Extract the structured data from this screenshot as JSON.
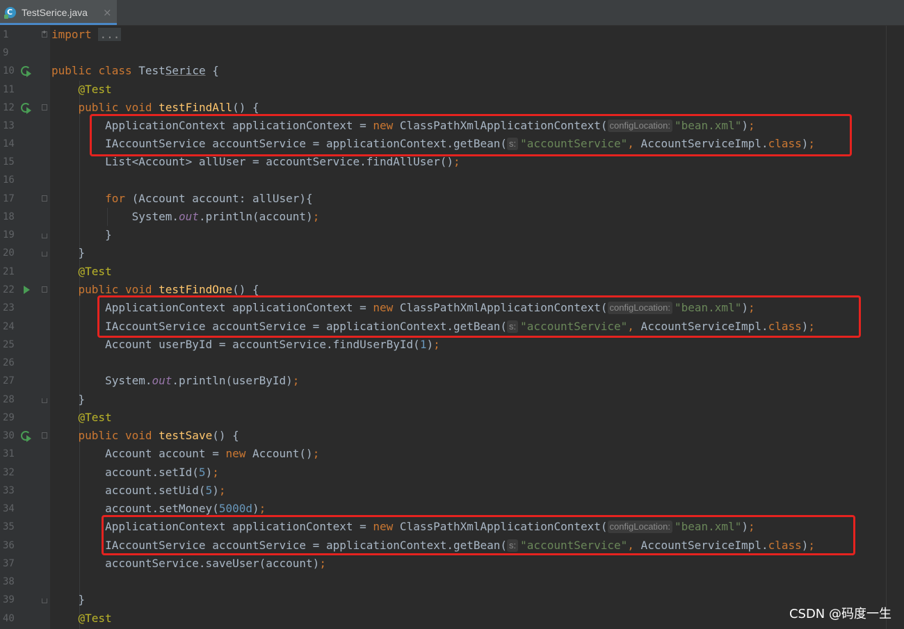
{
  "tab": {
    "title": "TestSerice.java",
    "close": "×"
  },
  "watermark": "CSDN @码度一生",
  "lines": {
    "l1": {
      "num": "1",
      "kw": "import",
      "folded": "..."
    },
    "l9": {
      "num": "9"
    },
    "l10": {
      "num": "10",
      "kw1": "public",
      "kw2": "class",
      "name": "TestSerice",
      "brace": "{"
    },
    "l11": {
      "num": "11",
      "ann": "@Test"
    },
    "l12": {
      "num": "12",
      "kw1": "public",
      "kw2": "void",
      "fn": "testFindAll",
      "tail": "() {"
    },
    "l13": {
      "num": "13",
      "pre": "ApplicationContext applicationContext = ",
      "kw": "new",
      "call": "ClassPathXmlApplicationContext(",
      "hint": "configLocation:",
      "str": "\"bean.xml\"",
      "end": ")",
      "semi": ";"
    },
    "l14": {
      "num": "14",
      "pre": "IAccountService accountService = applicationContext.getBean(",
      "hint": "s:",
      "str": "\"accountService\"",
      "comma": ",",
      "mid": " AccountServiceImpl.",
      "kw": "class",
      "end": ")",
      "semi": ";"
    },
    "l15": {
      "num": "15",
      "pre": "List<Account> allUser = accountService.findAllUser()",
      "semi": ";"
    },
    "l16": {
      "num": "16"
    },
    "l17": {
      "num": "17",
      "kw": "for",
      "rest": " (Account account: allUser){"
    },
    "l18": {
      "num": "18",
      "pre": "System.",
      "out": "out",
      "post": ".println(account)",
      "semi": ";"
    },
    "l19": {
      "num": "19",
      "text": "}"
    },
    "l20": {
      "num": "20",
      "text": "}"
    },
    "l21": {
      "num": "21",
      "ann": "@Test"
    },
    "l22": {
      "num": "22",
      "kw1": "public",
      "kw2": "void",
      "fn": "testFindOne",
      "tail": "() {"
    },
    "l23": {
      "num": "23",
      "pre": "ApplicationContext applicationContext = ",
      "kw": "new",
      "call": "ClassPathXmlApplicationContext(",
      "hint": "configLocation:",
      "str": "\"bean.xml\"",
      "end": ")",
      "semi": ";"
    },
    "l24": {
      "num": "24",
      "pre": "IAccountService accountService = applicationContext.getBean(",
      "hint": "s:",
      "str": "\"accountService\"",
      "comma": ",",
      "mid": " AccountServiceImpl.",
      "kw": "class",
      "end": ")",
      "semi": ";"
    },
    "l25": {
      "num": "25",
      "pre": "Account userById = accountService.findUserById(",
      "n": "1",
      "end": ")",
      "semi": ";"
    },
    "l26": {
      "num": "26"
    },
    "l27": {
      "num": "27",
      "pre": "System.",
      "out": "out",
      "post": ".println(userById)",
      "semi": ";"
    },
    "l28": {
      "num": "28",
      "text": "}"
    },
    "l29": {
      "num": "29",
      "ann": "@Test"
    },
    "l30": {
      "num": "30",
      "kw1": "public",
      "kw2": "void",
      "fn": "testSave",
      "tail": "() {"
    },
    "l31": {
      "num": "31",
      "pre": "Account account = ",
      "kw": "new",
      "post": " Account()",
      "semi": ";"
    },
    "l32": {
      "num": "32",
      "pre": "account.setId(",
      "n": "5",
      "end": ")",
      "semi": ";"
    },
    "l33": {
      "num": "33",
      "pre": "account.setUid(",
      "n": "5",
      "end": ")",
      "semi": ";"
    },
    "l34": {
      "num": "34",
      "pre": "account.setMoney(",
      "n": "5000d",
      "end": ")",
      "semi": ";"
    },
    "l35": {
      "num": "35",
      "pre": "ApplicationContext applicationContext = ",
      "kw": "new",
      "call": "ClassPathXmlApplicationContext(",
      "hint": "configLocation:",
      "str": "\"bean.xml\"",
      "end": ")",
      "semi": ";"
    },
    "l36": {
      "num": "36",
      "pre": "IAccountService accountService = applicationContext.getBean(",
      "hint": "s:",
      "str": "\"accountService\"",
      "comma": ",",
      "mid": " AccountServiceImpl.",
      "kw": "class",
      "end": ")",
      "semi": ";"
    },
    "l37": {
      "num": "37",
      "pre": "accountService.saveUser(account)",
      "semi": ";"
    },
    "l38": {
      "num": "38"
    },
    "l39": {
      "num": "39",
      "text": "}"
    },
    "l40": {
      "num": "40",
      "ann": "@Test"
    }
  }
}
